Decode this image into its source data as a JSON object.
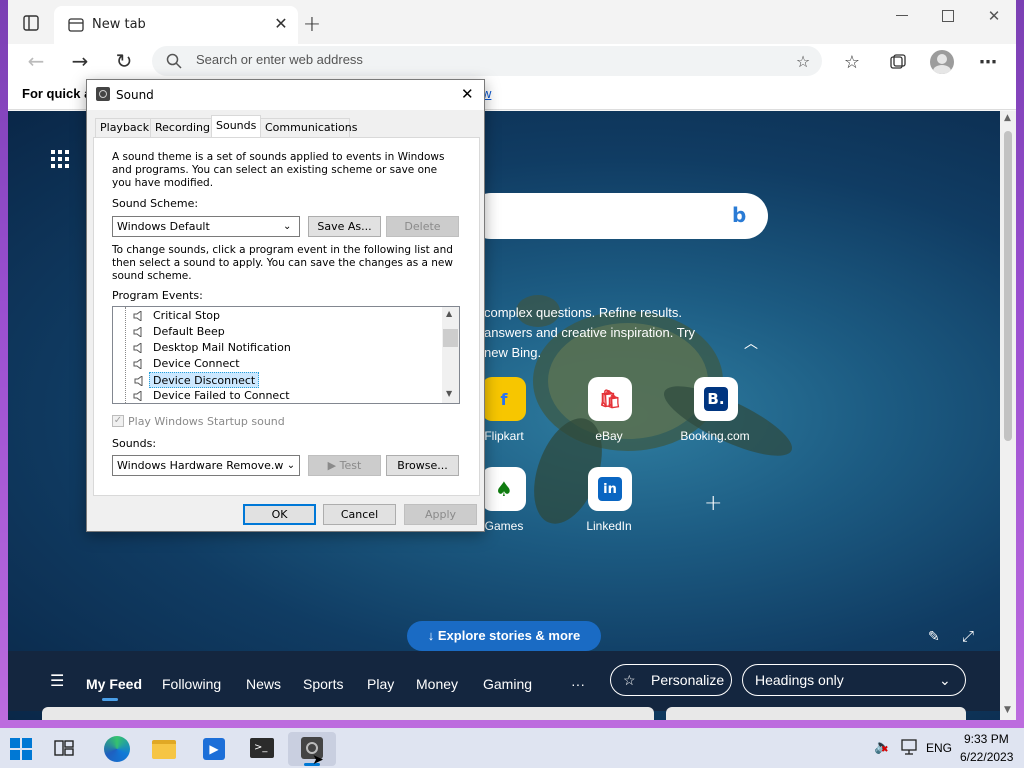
{
  "browser": {
    "tab_title": "New tab",
    "address_placeholder": "Search or enter web address",
    "favbar_text": "For quick ac",
    "favbar_link_fragment": "w"
  },
  "ntp": {
    "bing_promo_lines": [
      "complex questions. Refine results.",
      "answers and creative inspiration. Try",
      "new Bing."
    ],
    "tiles": [
      {
        "label": "Flipkart",
        "glyph": "f",
        "color": "#f7c600"
      },
      {
        "label": "eBay",
        "glyph": "🛍",
        "color": "#e53238"
      },
      {
        "label": "Booking.com",
        "glyph": "B.",
        "color": "#003580"
      },
      {
        "label": "Games",
        "glyph": "♠",
        "color": "#107c10"
      },
      {
        "label": "LinkedIn",
        "glyph": "in",
        "color": "#0a66c2"
      }
    ],
    "explore_label": "Explore stories & more",
    "feed_nav": [
      "My Feed",
      "Following",
      "News",
      "Sports",
      "Play",
      "Money",
      "Gaming"
    ],
    "more_label": "···",
    "personalize_label": "Personalize",
    "headings_label": "Headings only"
  },
  "dialog": {
    "title": "Sound",
    "tabs": [
      "Playback",
      "Recording",
      "Sounds",
      "Communications"
    ],
    "active_tab": "Sounds",
    "intro": "A sound theme is a set of sounds applied to events in Windows and programs.  You can select an existing scheme or save one you have modified.",
    "scheme_label": "Sound Scheme:",
    "scheme_value": "Windows Default",
    "save_as_label": "Save As...",
    "delete_label": "Delete",
    "change_text": "To change sounds, click a program event in the following list and then select a sound to apply.  You can save the changes as a new sound scheme.",
    "events_label": "Program Events:",
    "events": [
      "Critical Stop",
      "Default Beep",
      "Desktop Mail Notification",
      "Device Connect",
      "Device Disconnect",
      "Device Failed to Connect"
    ],
    "selected_event": "Device Disconnect",
    "startup_label": "Play Windows Startup sound",
    "sounds_label": "Sounds:",
    "sound_value": "Windows Hardware Remove.wav",
    "test_label": "Test",
    "browse_label": "Browse...",
    "ok_label": "OK",
    "cancel_label": "Cancel",
    "apply_label": "Apply"
  },
  "taskbar": {
    "language": "ENG",
    "time": "9:33 PM",
    "date": "6/22/2023"
  }
}
